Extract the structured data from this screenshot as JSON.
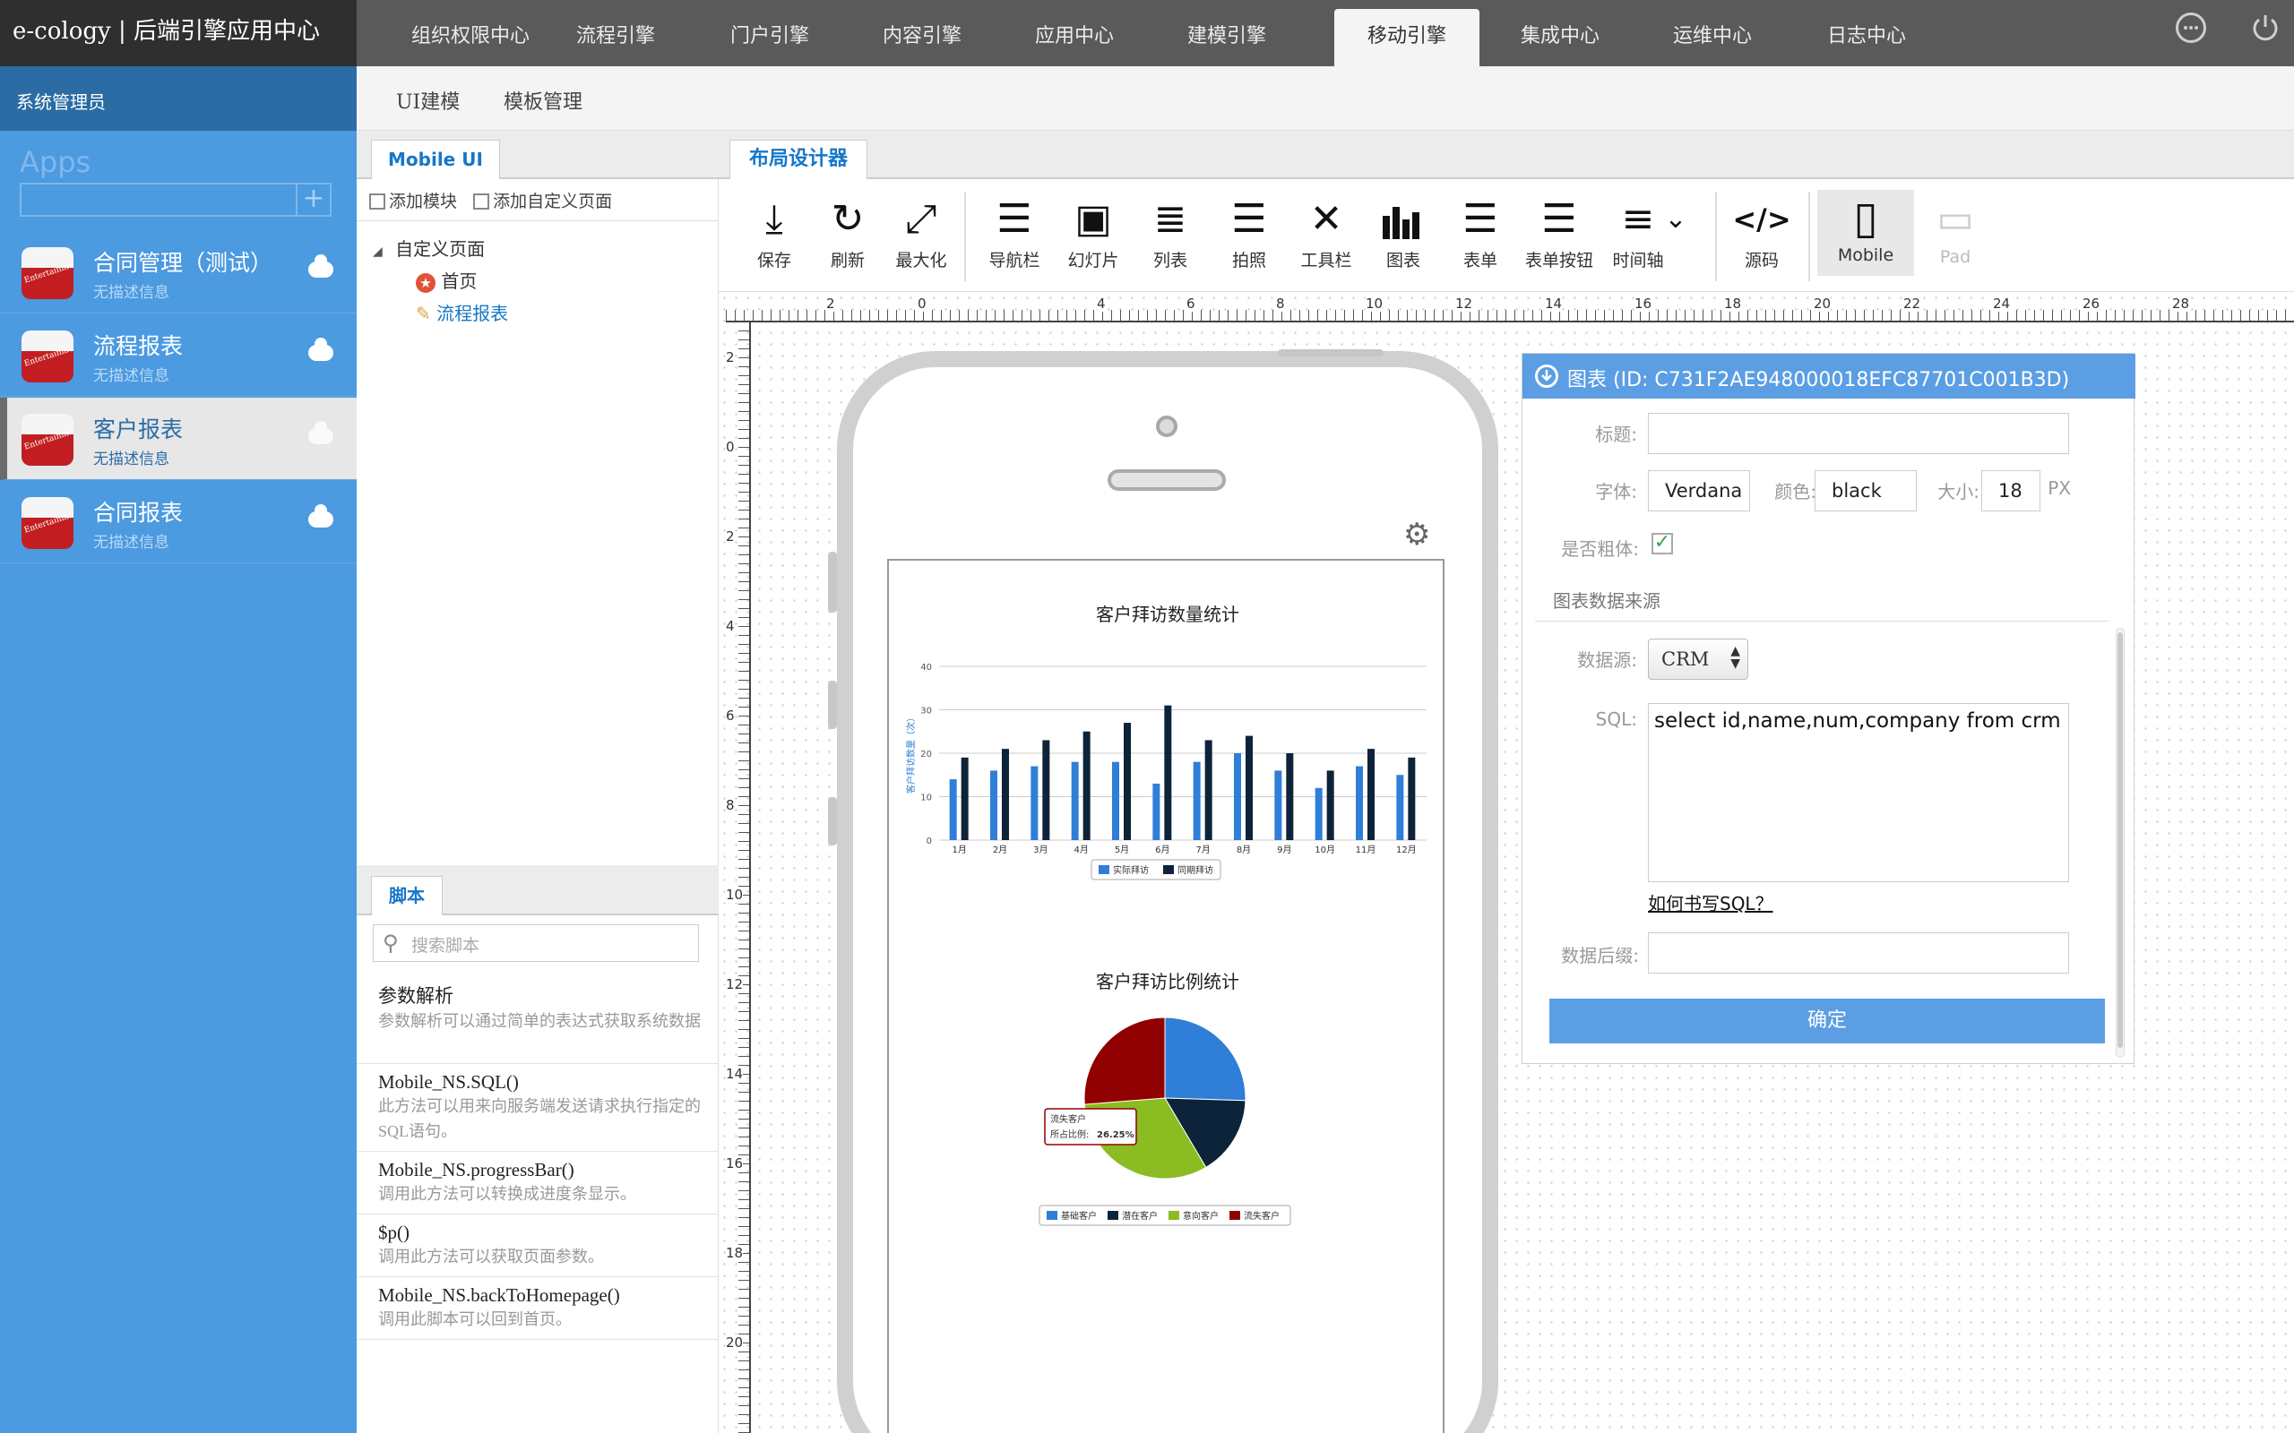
{
  "brand": "e-cology | 后端引擎应用中心",
  "topnav": [
    "组织权限中心",
    "流程引擎",
    "门户引擎",
    "内容引擎",
    "应用中心",
    "建模引擎",
    "移动引擎",
    "集成中心",
    "运维中心",
    "日志中心"
  ],
  "topnav_active": "移动引擎",
  "user": "系统管理员",
  "sidebar": {
    "apps_label": "Apps",
    "add_symbol": "+",
    "icon_text": "Entertainme",
    "items": [
      {
        "title": "合同管理（测试）",
        "desc": "无描述信息"
      },
      {
        "title": "流程报表",
        "desc": "无描述信息"
      },
      {
        "title": "客户报表",
        "desc": "无描述信息",
        "active": true
      },
      {
        "title": "合同报表",
        "desc": "无描述信息"
      }
    ]
  },
  "subnav": [
    "UI建模",
    "模板管理"
  ],
  "mobile_ui": {
    "tab": "Mobile UI",
    "add_module": "添加模块",
    "add_custom_page": "添加自定义页面",
    "tree": {
      "root": "自定义页面",
      "children": [
        "首页",
        "流程报表"
      ]
    }
  },
  "scripts": {
    "tab": "脚本",
    "search_placeholder": "搜索脚本",
    "items": [
      {
        "name": "参数解析",
        "desc": "参数解析可以通过简单的表达式获取系统数据"
      },
      {
        "name": "Mobile_NS.SQL()",
        "desc": "此方法可以用来向服务端发送请求执行指定的SQL语句。"
      },
      {
        "name": "Mobile_NS.progressBar()",
        "desc": "调用此方法可以转换成进度条显示。"
      },
      {
        "name": "$p()",
        "desc": "调用此方法可以获取页面参数。"
      },
      {
        "name": "Mobile_NS.backToHomepage()",
        "desc": "调用此脚本可以回到首页。"
      }
    ]
  },
  "designer": {
    "tab": "布局设计器",
    "tools": [
      {
        "label": "保存",
        "icon": "download-icon",
        "glyph": "⤓"
      },
      {
        "label": "刷新",
        "icon": "refresh-icon",
        "glyph": "↻"
      },
      {
        "label": "最大化",
        "icon": "expand-icon",
        "glyph": "⤢"
      },
      {
        "label": "导航栏",
        "icon": "navbar-icon",
        "glyph": "☰"
      },
      {
        "label": "幻灯片",
        "icon": "slideshow-icon",
        "glyph": "▣"
      },
      {
        "label": "列表",
        "icon": "list-icon",
        "glyph": "≣"
      },
      {
        "label": "拍照",
        "icon": "camera-icon",
        "glyph": "☰"
      },
      {
        "label": "工具栏",
        "icon": "tools-icon",
        "glyph": "✕"
      },
      {
        "label": "图表",
        "icon": "chart-icon",
        "glyph": "▮"
      },
      {
        "label": "表单",
        "icon": "form-icon",
        "glyph": "☰"
      },
      {
        "label": "表单按钮",
        "icon": "form-button-icon",
        "glyph": "☰"
      },
      {
        "label": "时间轴",
        "icon": "timeline-icon",
        "glyph": "≡"
      },
      {
        "label": "",
        "icon": "more-icon",
        "glyph": "⌄"
      },
      {
        "label": "源码",
        "icon": "code-icon",
        "glyph": "</>"
      },
      {
        "label": "Mobile",
        "icon": "mobile-icon",
        "glyph": "▯"
      },
      {
        "label": "Pad",
        "icon": "pad-icon",
        "glyph": "▭"
      }
    ],
    "ruler_h": [
      "2",
      "0",
      "4",
      "6",
      "8",
      "10",
      "12",
      "14",
      "16",
      "18",
      "20",
      "22",
      "24",
      "26",
      "28"
    ],
    "ruler_v": [
      "2",
      "0",
      "2",
      "4",
      "6",
      "8",
      "10",
      "12",
      "14",
      "16",
      "18",
      "20"
    ]
  },
  "chart_data": [
    {
      "type": "bar",
      "title": "客户拜访数量统计",
      "ylabel": "客户拜访数量（次）",
      "ylim": [
        0,
        40
      ],
      "yticks": [
        "0",
        "10",
        "20",
        "30",
        "40"
      ],
      "categories": [
        "1月",
        "2月",
        "3月",
        "4月",
        "5月",
        "6月",
        "7月",
        "8月",
        "9月",
        "10月",
        "11月",
        "12月"
      ],
      "series": [
        {
          "name": "实际拜访",
          "color": "#2f7ed8",
          "values": [
            14,
            16,
            17,
            18,
            18,
            13,
            18,
            20,
            16,
            12,
            17,
            15
          ]
        },
        {
          "name": "同期拜访",
          "color": "#0d233a",
          "values": [
            19,
            21,
            23,
            25,
            27,
            31,
            23,
            24,
            20,
            16,
            21,
            19
          ]
        }
      ],
      "legend": "bottom"
    },
    {
      "type": "pie",
      "title": "客户拜访比例统计",
      "slices": [
        {
          "name": "基础客户",
          "color": "#2f7ed8",
          "value": 25.5
        },
        {
          "name": "潜在客户",
          "color": "#0d233a",
          "value": 16.0
        },
        {
          "name": "意向客户",
          "color": "#8bbc21",
          "value": 32.25
        },
        {
          "name": "流失客户",
          "color": "#910000",
          "value": 26.25
        }
      ],
      "tooltip": {
        "name": "流失客户",
        "label": "所占比例:",
        "value": "26.25%"
      },
      "legend": "bottom"
    }
  ],
  "props": {
    "header": "图表 (ID: C731F2AE948000018EFC87701C001B3D)",
    "title_label": "标题:",
    "title_value": "",
    "font_label": "字体:",
    "font_value": "Verdana",
    "color_label": "颜色:",
    "color_value": "black",
    "size_label": "大小:",
    "size_value": "18",
    "size_unit": "PX",
    "bold_label": "是否粗体:",
    "bold_check": "✓",
    "section": "图表数据来源",
    "ds_label": "数据源:",
    "ds_value": "CRM",
    "sql_label": "SQL:",
    "sql_value": "select id,name,num,company from crm",
    "help_link": "如何书写SQL？",
    "suffix_label": "数据后缀:",
    "suffix_value": "",
    "confirm": "确定"
  }
}
